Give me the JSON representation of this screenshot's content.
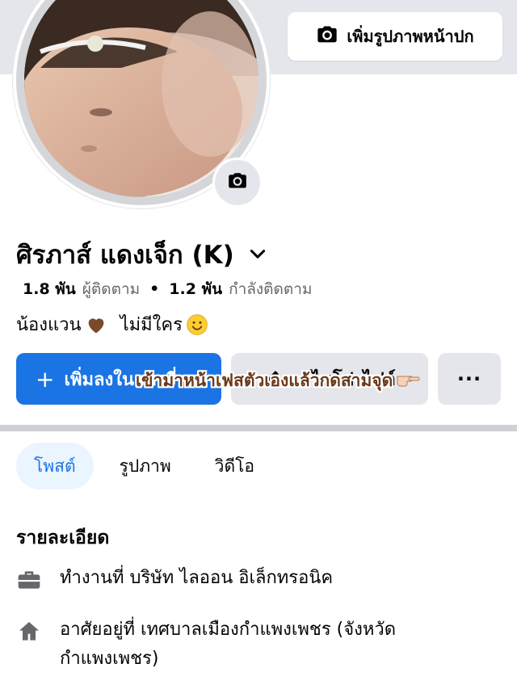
{
  "cover": {
    "add_cover_label": "เพิ่มรูปภาพหน้าปก"
  },
  "profile": {
    "name": "ศิรภาส์ แดงเจ็ก (K)",
    "followers_count": "1.8 พัน",
    "followers_label": "ผู้ติดตาม",
    "following_count": "1.2 พัน",
    "following_label": "กำลังติดตาม",
    "bio_text_1": "น้องแวน",
    "bio_text_2": "ไม่มีใคร"
  },
  "actions": {
    "add_story_label": "เพิ่มลงในสตอรี่",
    "edit_profile_label": "แก้ไขโปรไฟล์",
    "more_label": "···"
  },
  "overlay": {
    "caption": "เข้ามาหน้าเฟสตัวเองแล้วกดสามจุด"
  },
  "tabs": [
    {
      "label": "โพสต์",
      "active": true
    },
    {
      "label": "รูปภาพ",
      "active": false
    },
    {
      "label": "วิดีโอ",
      "active": false
    }
  ],
  "details": {
    "title": "รายละเอียด",
    "work": "ทำงานที่ บริษัท ไลออน อิเล็กทรอนิค",
    "lives": "อาศัยอยู่ที่ เทศบาลเมืองกำแพงเพชร (จังหวัดกำแพงเพชร)"
  },
  "icons": {
    "camera": "camera-icon",
    "chevron": "chevron-down-icon",
    "work": "briefcase-icon",
    "home": "home-icon"
  },
  "colors": {
    "accent": "#1b74e4",
    "secondary_button": "#e4e6eb",
    "muted_text": "#65676b"
  }
}
